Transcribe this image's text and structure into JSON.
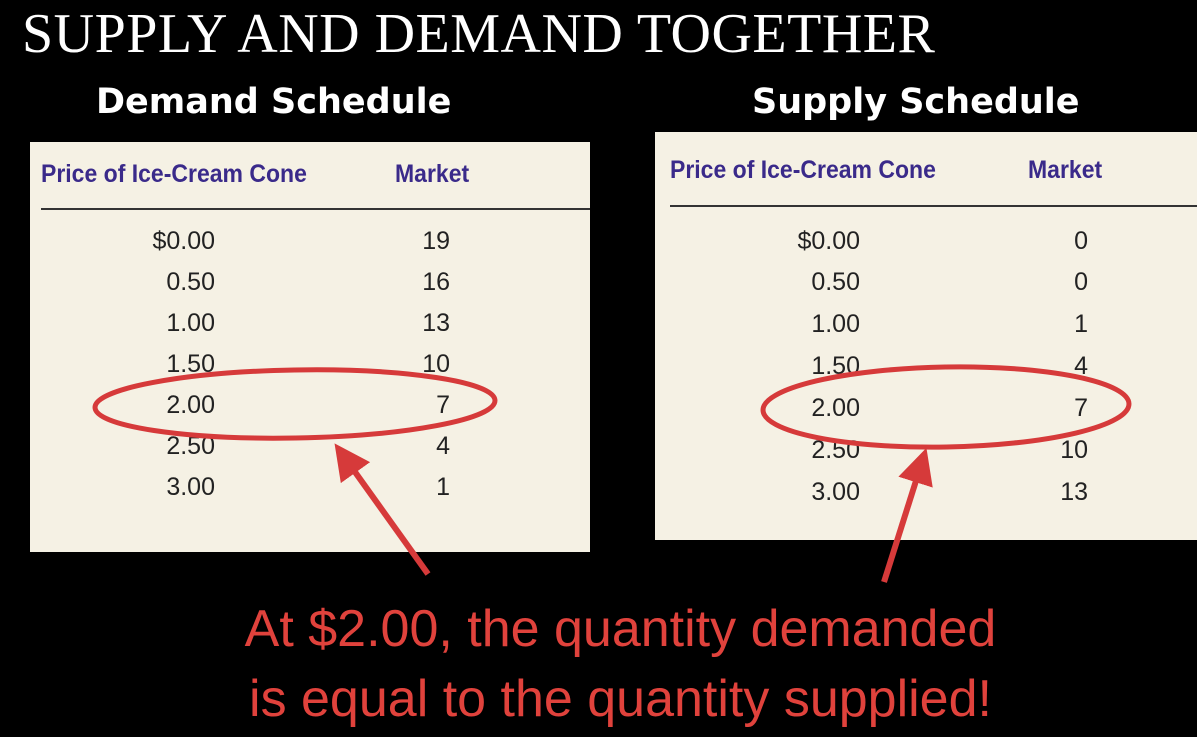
{
  "title": "SUPPLY AND DEMAND TOGETHER",
  "demand": {
    "heading": "Demand Schedule",
    "col_price": "Price of Ice-Cream Cone",
    "col_qty": "Market",
    "rows": [
      {
        "price": "$0.00",
        "qty": "19"
      },
      {
        "price": "0.50",
        "qty": "16"
      },
      {
        "price": "1.00",
        "qty": "13"
      },
      {
        "price": "1.50",
        "qty": "10"
      },
      {
        "price": "2.00",
        "qty": "7"
      },
      {
        "price": "2.50",
        "qty": "4"
      },
      {
        "price": "3.00",
        "qty": "1"
      }
    ]
  },
  "supply": {
    "heading": "Supply Schedule",
    "col_price": "Price of Ice-Cream Cone",
    "col_qty": "Market",
    "rows": [
      {
        "price": "$0.00",
        "qty": "0"
      },
      {
        "price": "0.50",
        "qty": "0"
      },
      {
        "price": "1.00",
        "qty": "1"
      },
      {
        "price": "1.50",
        "qty": "4"
      },
      {
        "price": "2.00",
        "qty": "7"
      },
      {
        "price": "2.50",
        "qty": "10"
      },
      {
        "price": "3.00",
        "qty": "13"
      }
    ]
  },
  "caption": {
    "line1": "At $2.00, the quantity demanded",
    "line2": "is equal to the quantity supplied!"
  },
  "colors": {
    "background": "#000000",
    "panel": "#f5f1e4",
    "header_text": "#3a2a8a",
    "highlight": "#d63a3a",
    "caption": "#e0423c"
  }
}
